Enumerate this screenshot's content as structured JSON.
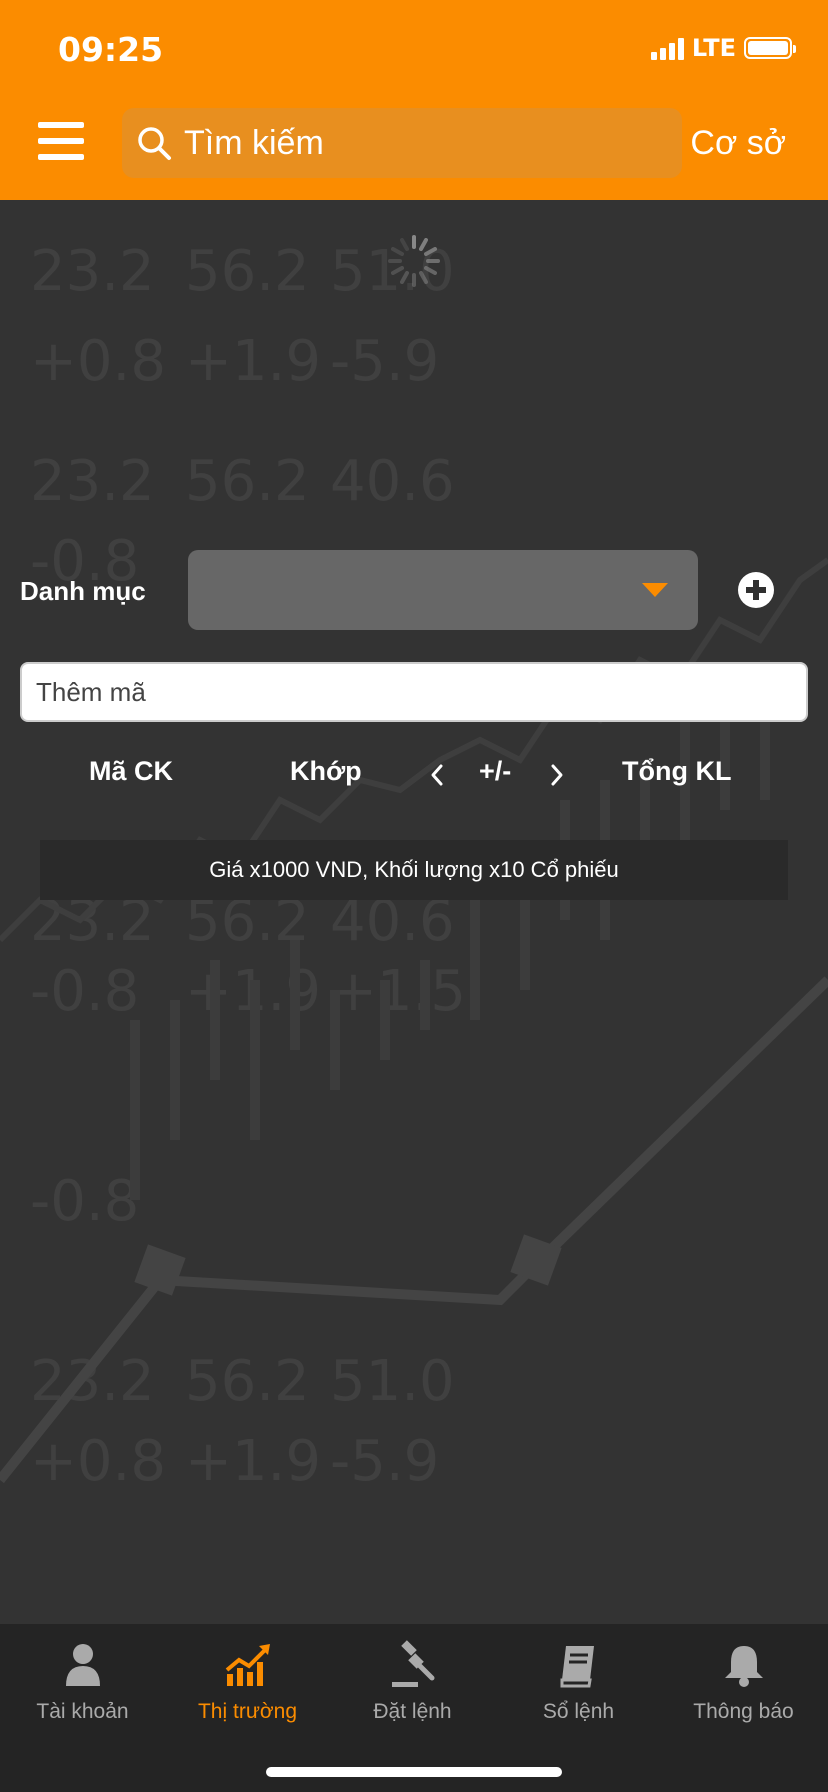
{
  "status_bar": {
    "time": "09:25",
    "network": "LTE"
  },
  "header": {
    "search_placeholder": "Tìm kiếm",
    "market_label": "Cơ sở"
  },
  "watchlist": {
    "label": "Danh mục",
    "selected": "",
    "add_placeholder": "Thêm mã"
  },
  "columns": {
    "code": "Mã CK",
    "match": "Khớp",
    "change": "+/-",
    "volume": "Tổng KL"
  },
  "note": "Giá x1000 VND, Khối lượng x10 Cổ phiếu",
  "tabs": [
    {
      "label": "Tài khoản",
      "icon": "user-icon"
    },
    {
      "label": "Thị trường",
      "icon": "chart-trend-icon"
    },
    {
      "label": "Đặt lệnh",
      "icon": "gavel-icon"
    },
    {
      "label": "Sổ lệnh",
      "icon": "book-icon"
    },
    {
      "label": "Thông báo",
      "icon": "bell-icon"
    }
  ],
  "colors": {
    "accent": "#fb8c00",
    "background": "#2f2f2f",
    "tabbar": "#242424"
  }
}
